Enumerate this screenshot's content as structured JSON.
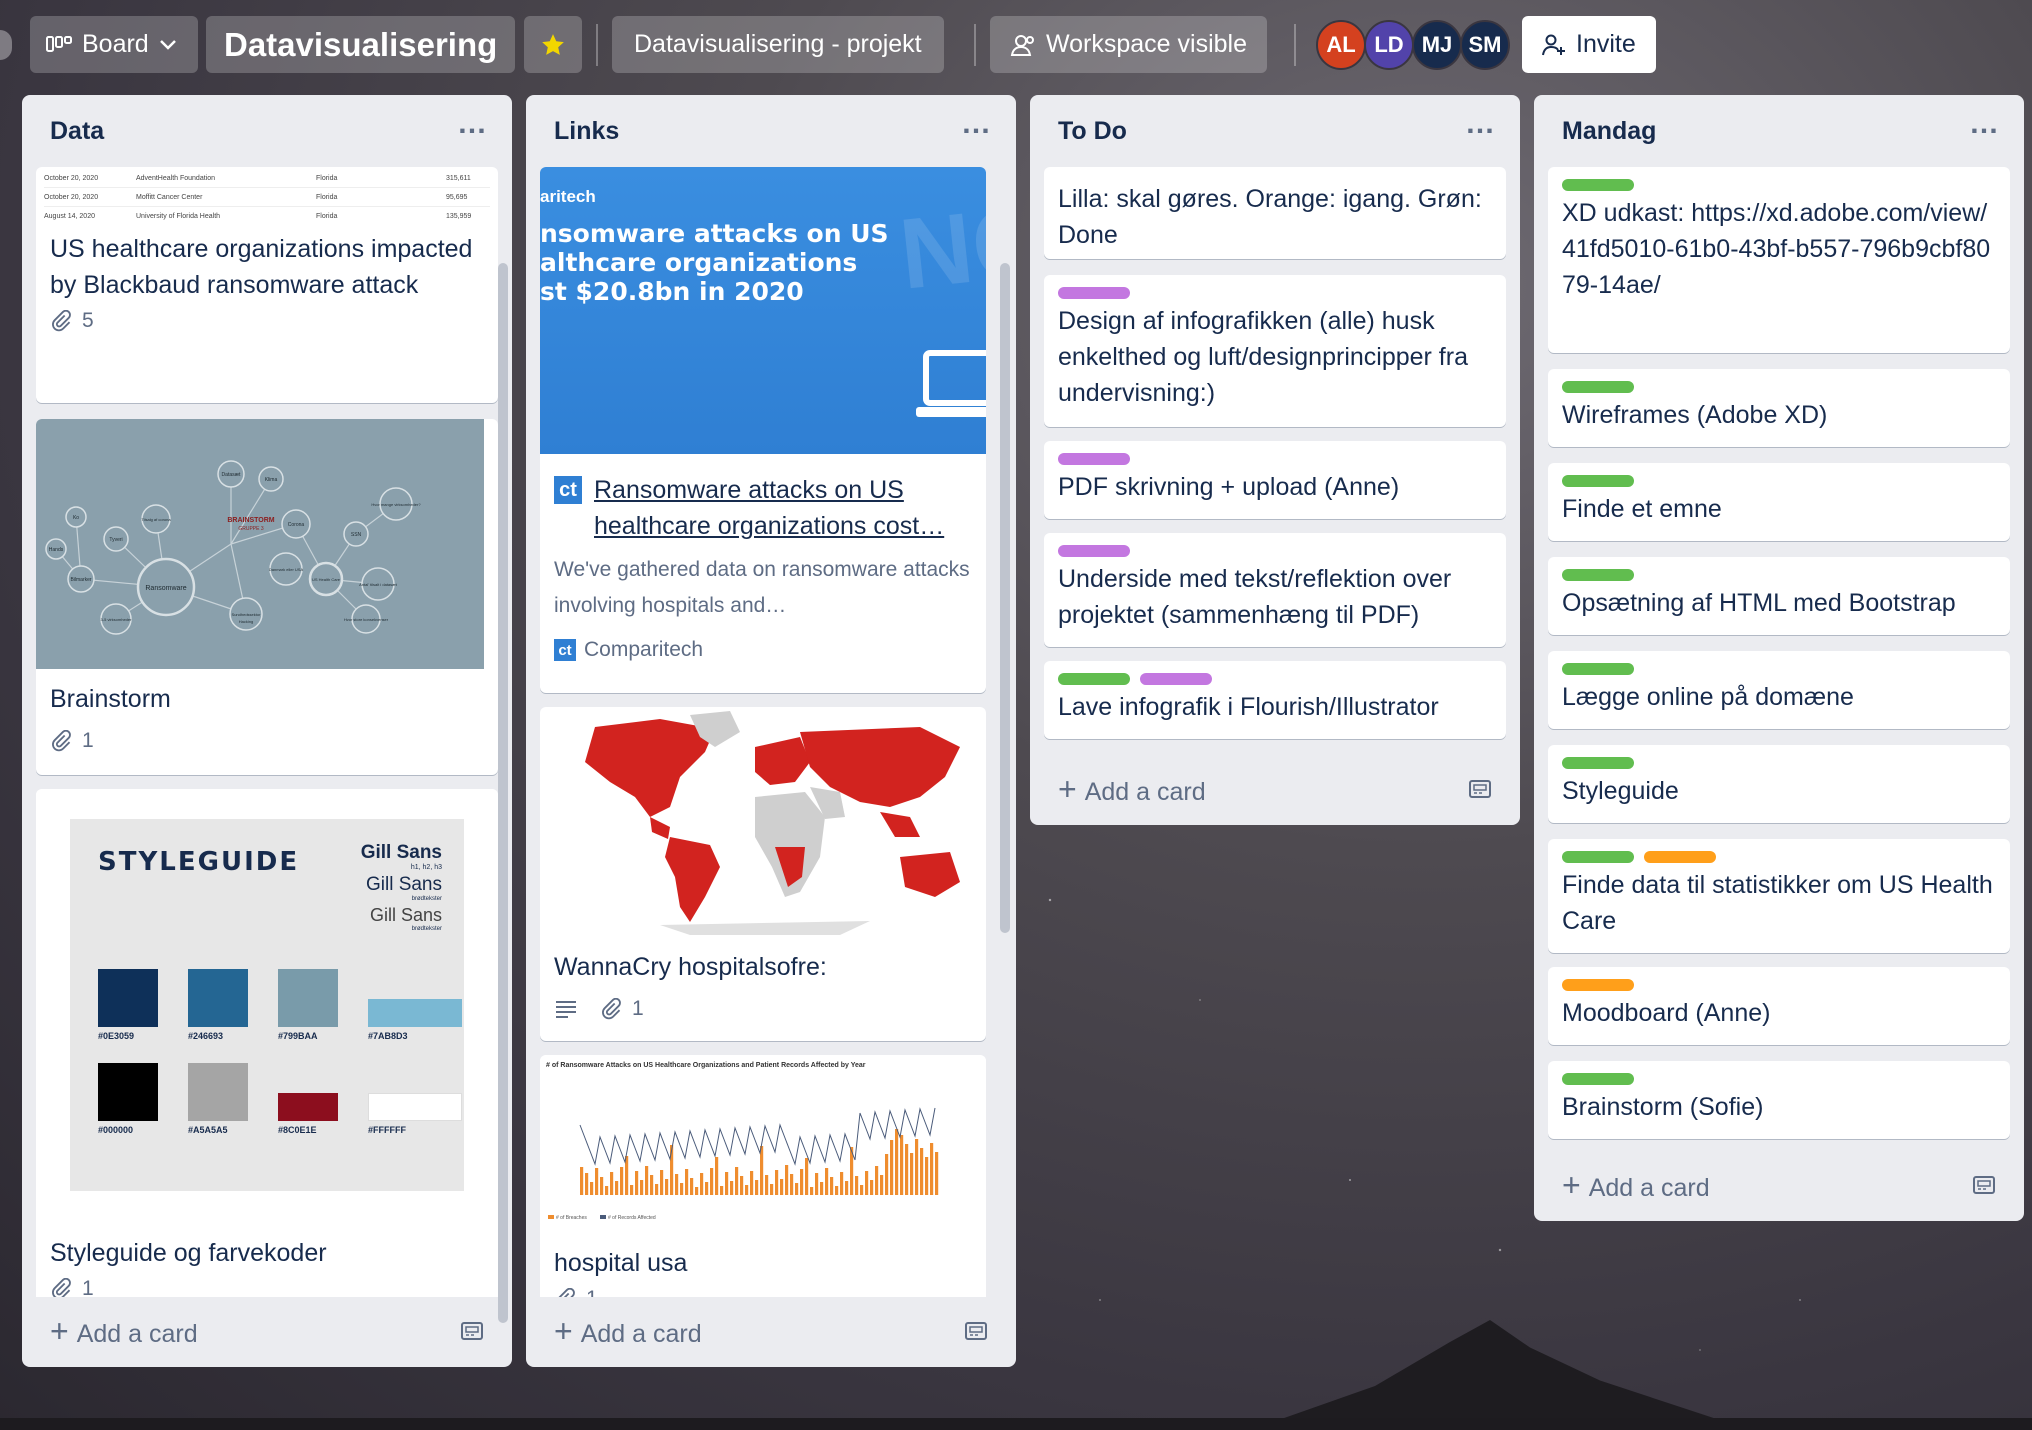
{
  "topbar": {
    "board_view": "Board",
    "board_title": "Datavisualisering",
    "workspace": "Datavisualisering - projekt",
    "visibility": "Workspace visible",
    "invite": "Invite",
    "members": [
      {
        "initials": "AL",
        "color": "#d4411f"
      },
      {
        "initials": "LD",
        "color": "#5243aa"
      },
      {
        "initials": "MJ",
        "color": "#172b4d"
      },
      {
        "initials": "SM",
        "color": "#172b4d"
      }
    ]
  },
  "colors": {
    "green": "#61bd4f",
    "purple": "#c377e0",
    "orange": "#ff9f1a",
    "link": "#0c66e4"
  },
  "lists": [
    {
      "title": "Data",
      "add": "Add a card",
      "cards": [
        {
          "title": "US healthcare organizations impacted by Blackbaud ransomware attack",
          "attachments": "5",
          "cover_rows": [
            [
              "October 20, 2020",
              "AdventHealth Foundation",
              "Florida",
              "315,611"
            ],
            [
              "October 20, 2020",
              "Moffitt Cancer Center",
              "Florida",
              "95,695"
            ],
            [
              "August 14, 2020",
              "University of Florida Health",
              "Florida",
              "135,959"
            ]
          ]
        },
        {
          "title": "Brainstorm",
          "attachments": "1",
          "cover": {
            "center": "BRAINSTORM",
            "center_sub": "GRUPPE 3",
            "nodes": [
              "Ransomware",
              "Datasæt",
              "Klima",
              "Corona",
              "Tilsalg af corona",
              "Tyveri",
              "Ko",
              "Hands",
              "Bilmarker",
              "3-5 virksomheder",
              "Sundhedssektor",
              "Hacking",
              "Danmark eller USA",
              "US Health Care",
              "SSN",
              "Hvor mange virksomheder?",
              "Antal' tilsalt i datasæt",
              "Hvor store konsekvenser"
            ]
          }
        },
        {
          "title": "Styleguide og farvekoder",
          "attachments": "1",
          "cover": {
            "heading": "STYLEGUIDE",
            "font1": "Gill Sans",
            "font1_sub": "h1, h2, h3",
            "font2": "Gill Sans",
            "font2_sub": "brødtekster",
            "font3": "Gill Sans",
            "font3_sub": "brødtekster",
            "swatches": [
              {
                "hex": "#0E3059"
              },
              {
                "hex": "#246693"
              },
              {
                "hex": "#799BAA"
              },
              {
                "hex": "#7AB8D3"
              },
              {
                "hex": "#000000"
              },
              {
                "hex": "#A5A5A5"
              },
              {
                "hex": "#8C0E1E"
              },
              {
                "hex": "#FFFFFF"
              }
            ]
          }
        }
      ]
    },
    {
      "title": "Links",
      "add": "Add a card",
      "cards": [
        {
          "title": "Ransomware attacks on US healthcare organizations cost…",
          "description": "We've gathered data on ransomware attacks involving hospitals and…",
          "source_icon": "ct",
          "source": "Comparitech",
          "cover": {
            "brand": "aritech",
            "headline": [
              "nsomware attacks on US",
              "althcare organizations",
              "st $20.8bn in 2020"
            ],
            "bg_text": "NCY"
          }
        },
        {
          "title": "WannaCry hospitalsofre:",
          "attachments": "1"
        },
        {
          "title": "hospital usa",
          "attachments": "1",
          "cover": {
            "chart_title": "# of Ransomware Attacks on US Healthcare Organizations and Patient Records Affected by Year",
            "legend": [
              "# of Breaches",
              "# of Records Affected"
            ]
          }
        }
      ]
    },
    {
      "title": "To Do",
      "add": "Add a card",
      "cards": [
        {
          "title": "Lilla: skal gøres. Orange: igang. Grøn: Done",
          "labels": []
        },
        {
          "title": "Design af infografikken (alle) husk enkelthed og luft/designprincipper fra undervisning:)",
          "labels": [
            "purple"
          ]
        },
        {
          "title": "PDF skrivning + upload (Anne)",
          "labels": [
            "purple"
          ]
        },
        {
          "title": "Underside med tekst/reflektion over projektet (sammenhæng til PDF)",
          "labels": [
            "purple"
          ]
        },
        {
          "title": "Lave infografik i Flourish/Illustrator",
          "labels": [
            "green",
            "purple"
          ]
        }
      ]
    },
    {
      "title": "Mandag",
      "add": "Add a card",
      "cards": [
        {
          "title": "XD udkast: https://xd.adobe.com/view/41fd5010-61b0-43bf-b557-796b9cbf8079-14ae/",
          "labels": [
            "green"
          ]
        },
        {
          "title": "Wireframes (Adobe XD)",
          "labels": [
            "green"
          ]
        },
        {
          "title": "Finde et emne",
          "labels": [
            "green"
          ]
        },
        {
          "title": "Opsætning af HTML med Bootstrap",
          "labels": [
            "green"
          ]
        },
        {
          "title": "Lægge online på domæne",
          "labels": [
            "green"
          ]
        },
        {
          "title": "Styleguide",
          "labels": [
            "green"
          ]
        },
        {
          "title": "Finde data til statistikker om US Health Care",
          "labels": [
            "green",
            "orange"
          ]
        },
        {
          "title": "Moodboard (Anne)",
          "labels": [
            "orange"
          ]
        },
        {
          "title": "Brainstorm (Sofie)",
          "labels": [
            "green"
          ]
        }
      ]
    }
  ]
}
